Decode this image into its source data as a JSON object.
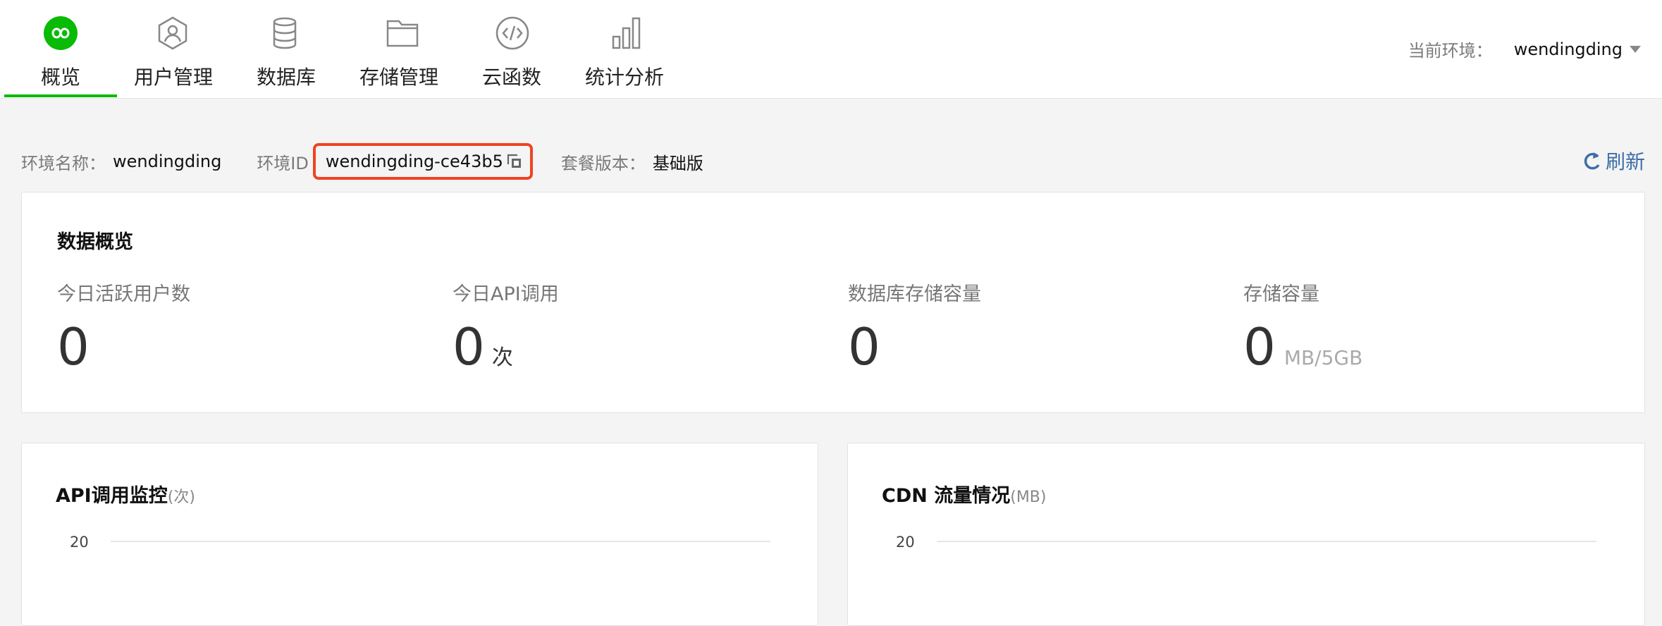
{
  "nav": {
    "items": [
      {
        "label": "概览",
        "icon": "infinity-icon"
      },
      {
        "label": "用户管理",
        "icon": "user-icon"
      },
      {
        "label": "数据库",
        "icon": "database-icon"
      },
      {
        "label": "存储管理",
        "icon": "folder-icon"
      },
      {
        "label": "云函数",
        "icon": "code-icon"
      },
      {
        "label": "统计分析",
        "icon": "bar-chart-icon"
      }
    ],
    "active_index": 0,
    "env_label": "当前环境：",
    "env_value": "wendingding"
  },
  "info": {
    "env_name_label": "环境名称：",
    "env_name_value": "wendingding",
    "env_id_label": "环境ID",
    "env_id_value": "wendingding-ce43b5",
    "plan_label": "套餐版本：",
    "plan_value": "基础版",
    "refresh_label": "刷新"
  },
  "overview": {
    "title": "数据概览",
    "stats": [
      {
        "label": "今日活跃用户数",
        "value": "0",
        "unit": ""
      },
      {
        "label": "今日API调用",
        "value": "0",
        "unit": "次"
      },
      {
        "label": "数据库存储容量",
        "value": "0",
        "unit": ""
      },
      {
        "label": "存储容量",
        "value": "0",
        "unit": "MB/5GB"
      }
    ]
  },
  "charts": {
    "api": {
      "title": "API调用监控",
      "unit": "(次)",
      "tick": "20"
    },
    "cdn": {
      "title": "CDN 流量情况",
      "unit": "(MB)",
      "tick": "20"
    }
  },
  "colors": {
    "accent_green": "#09bb07",
    "highlight_red": "#ee4422",
    "link_blue": "#3d6ea8"
  }
}
